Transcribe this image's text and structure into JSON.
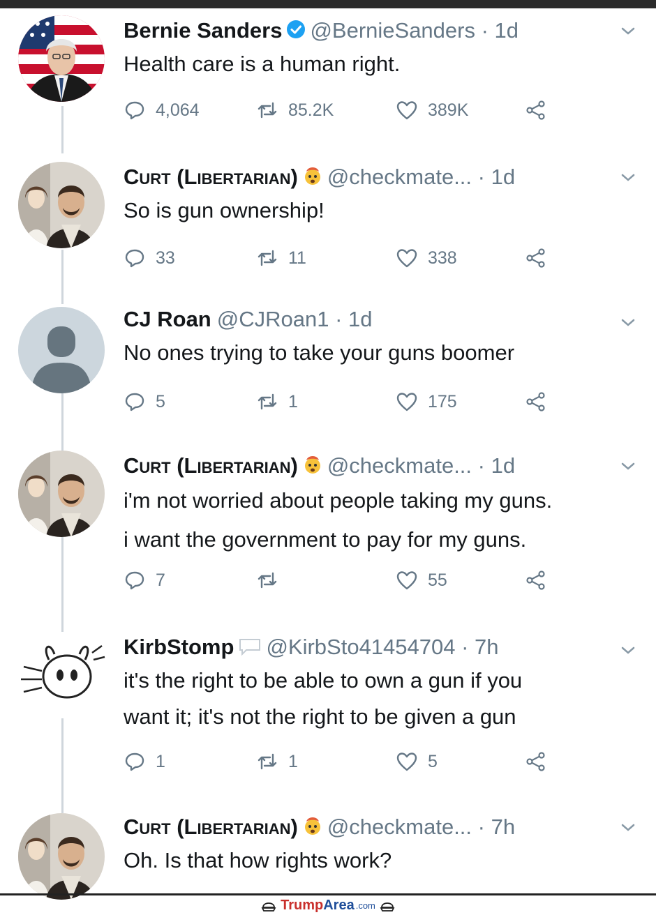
{
  "tweets": [
    {
      "name": "Bernie Sanders",
      "handle": "@BernieSanders · 1d",
      "verified": true,
      "lines": [
        "Health care is a human right."
      ],
      "reply": "4,064",
      "retweet": "85.2K",
      "like": "389K"
    },
    {
      "name": "Curt (Libertarian)",
      "handle": "@checkmate...  · 1d",
      "lines": [
        "So is gun ownership!"
      ],
      "reply": "33",
      "retweet": "11",
      "like": "338"
    },
    {
      "name": "CJ Roan",
      "handle": "@CJRoan1 · 1d",
      "lines": [
        "No ones trying to take your guns boomer"
      ],
      "reply": "5",
      "retweet": "1",
      "like": "175"
    },
    {
      "name": "Curt (Libertarian)",
      "handle": "@checkmate...  · 1d",
      "lines": [
        "i'm not worried about people taking my guns.",
        "i want the government to pay for my guns."
      ],
      "reply": "7",
      "retweet": "",
      "like": "55"
    },
    {
      "name": "KirbStomp",
      "handle": "@KirbSto41454704 · 7h",
      "lines": [
        "it's the right to be able to own a gun if you",
        "want it; it's not the right to be given a gun"
      ],
      "reply": "1",
      "retweet": "1",
      "like": "5"
    },
    {
      "name": "Curt (Libertarian)",
      "handle": "@checkmate...  · 7h",
      "lines": [
        "Oh. Is that how rights work?"
      ]
    }
  ],
  "footer": {
    "brand_a": "Trump",
    "brand_b": "Area",
    "tld": ".com"
  },
  "colors": {
    "verified": "#1da1f2",
    "muted": "#657786",
    "text": "#14171a",
    "thread": "#cfd6dc"
  }
}
